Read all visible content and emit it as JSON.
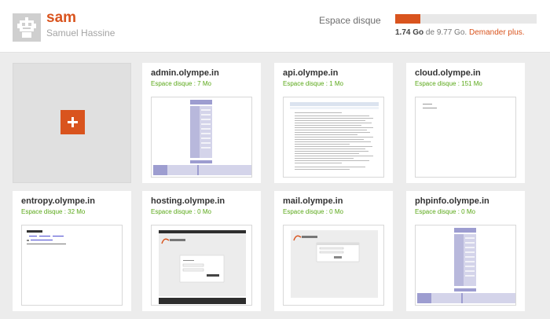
{
  "header": {
    "avatar_icon": "robot-avatar-icon",
    "username": "sam",
    "fullname": "Samuel Hassine",
    "disk": {
      "label": "Espace disque",
      "used_fraction": 0.178,
      "used": "1.74 Go",
      "of_text": " de 9.77 Go. ",
      "request_link": "Demander plus."
    }
  },
  "add_button": {
    "icon": "plus-icon"
  },
  "sites": [
    {
      "name": "admin.olympe.in",
      "disk": "Espace disque : 7 Mo",
      "preview": "php-info-page"
    },
    {
      "name": "api.olympe.in",
      "disk": "Espace disque : 1 Mo",
      "preview": "text-document-page"
    },
    {
      "name": "cloud.olympe.in",
      "disk": "Espace disque : 151 Mo",
      "preview": "mostly-blank-page"
    },
    {
      "name": "entropy.olympe.in",
      "disk": "Espace disque : 32 Mo",
      "preview": "index-listing-page"
    },
    {
      "name": "hosting.olympe.in",
      "disk": "Espace disque : 0 Mo",
      "preview": "olympe-login-page"
    },
    {
      "name": "mail.olympe.in",
      "disk": "Espace disque : 0 Mo",
      "preview": "olympe-mail-login-page"
    },
    {
      "name": "phpinfo.olympe.in",
      "disk": "Espace disque : 0 Mo",
      "preview": "php-info-page"
    }
  ],
  "colors": {
    "accent": "#d9541e",
    "disk_green": "#5aa818",
    "background": "#ececec"
  }
}
